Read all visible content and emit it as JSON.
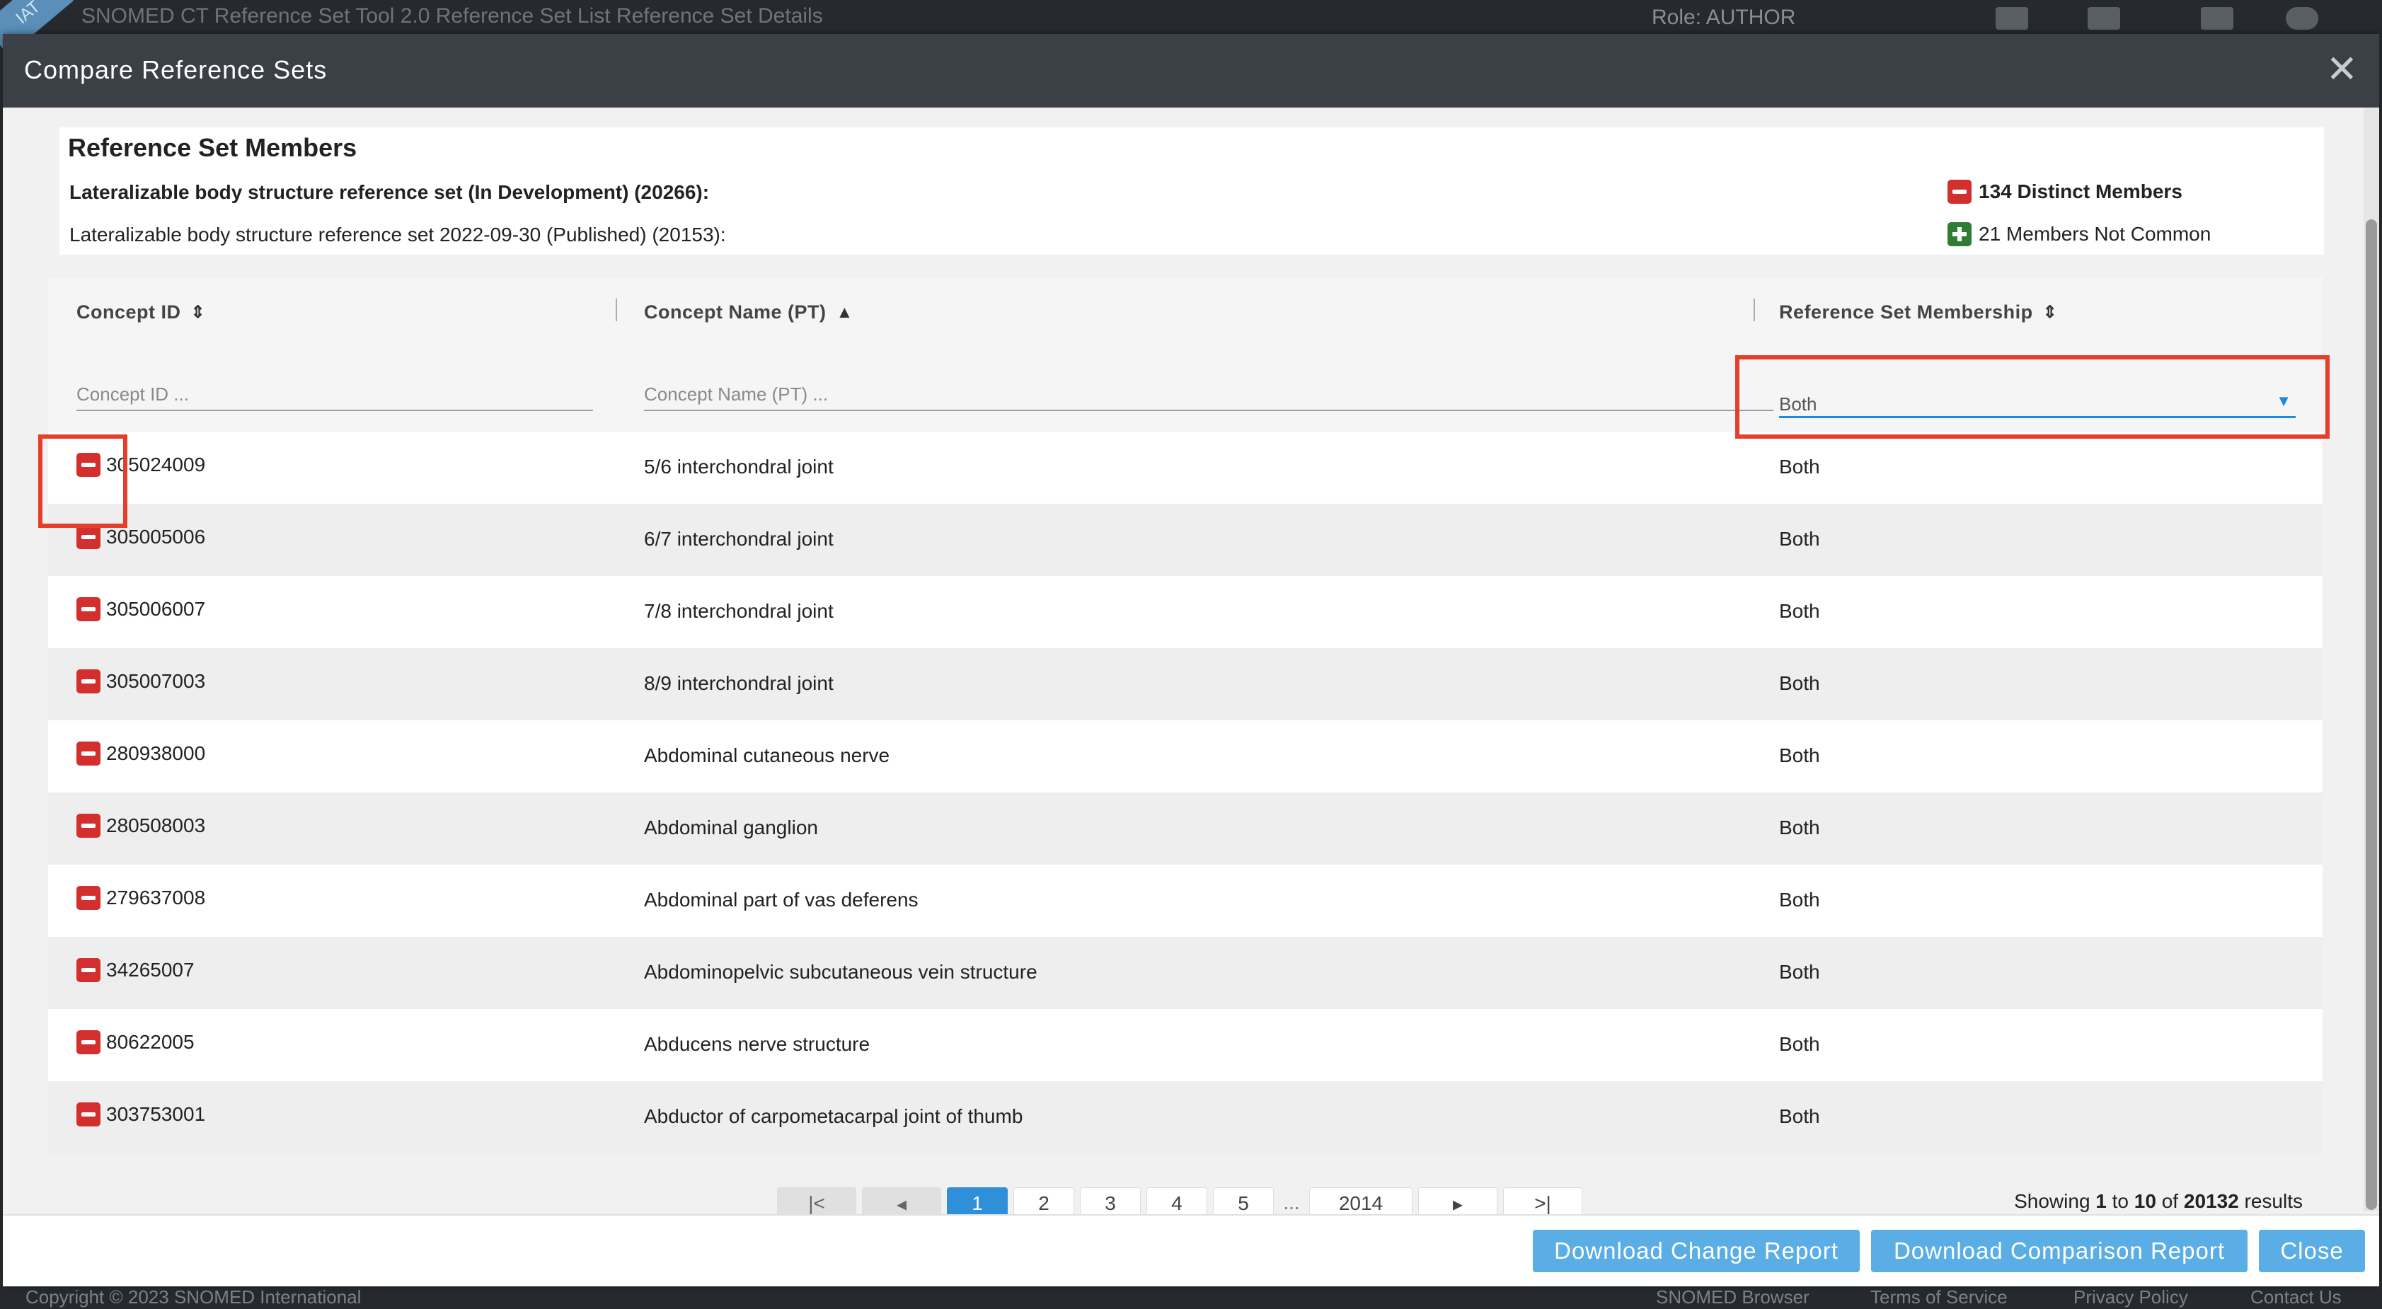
{
  "background": {
    "ribbon": "IAT",
    "app_title": "SNOMED CT Reference Set Tool 2.0   Reference Set List   Reference Set Details",
    "role": "Role: AUTHOR",
    "footer_left": "Copyright © 2023 SNOMED International",
    "footer_links": [
      "SNOMED Browser",
      "Terms of Service",
      "Privacy Policy",
      "Contact Us"
    ]
  },
  "modal": {
    "title": "Compare Reference Sets",
    "close": "✕"
  },
  "summary": {
    "title": "Reference Set Members",
    "line1": "Lateralizable body structure reference set (In Development) (20266):",
    "line2": "Lateralizable body structure reference set 2022-09-30 (Published) (20153):",
    "stat1": "134 Distinct Members",
    "stat2": "21 Members Not Common"
  },
  "table": {
    "columns": [
      {
        "label": "Concept ID",
        "sort": "⇕"
      },
      {
        "label": "Concept Name (PT)",
        "sort": "▲"
      },
      {
        "label": "Reference Set Membership",
        "sort": "⇕"
      }
    ],
    "filters": {
      "concept_id_placeholder": "Concept ID ...",
      "concept_name_placeholder": "Concept Name (PT) ...",
      "membership_value": "Both"
    },
    "rows": [
      {
        "id": "305024009",
        "name": "5/6 interchondral joint",
        "membership": "Both"
      },
      {
        "id": "305005006",
        "name": "6/7 interchondral joint",
        "membership": "Both"
      },
      {
        "id": "305006007",
        "name": "7/8 interchondral joint",
        "membership": "Both"
      },
      {
        "id": "305007003",
        "name": "8/9 interchondral joint",
        "membership": "Both"
      },
      {
        "id": "280938000",
        "name": "Abdominal cutaneous nerve",
        "membership": "Both"
      },
      {
        "id": "280508003",
        "name": "Abdominal ganglion",
        "membership": "Both"
      },
      {
        "id": "279637008",
        "name": "Abdominal part of vas deferens",
        "membership": "Both"
      },
      {
        "id": "34265007",
        "name": "Abdominopelvic subcutaneous vein structure",
        "membership": "Both"
      },
      {
        "id": "80622005",
        "name": "Abducens nerve structure",
        "membership": "Both"
      },
      {
        "id": "303753001",
        "name": "Abductor of carpometacarpal joint of thumb",
        "membership": "Both"
      }
    ]
  },
  "pagination": {
    "first": "|<",
    "prev": "◂",
    "pages": [
      "1",
      "2",
      "3",
      "4",
      "5"
    ],
    "ellipsis": "...",
    "last_page": "2014",
    "next": "▸",
    "last": ">|",
    "showing_prefix": "Showing",
    "showing_from": "1",
    "showing_to_word": "to",
    "showing_to": "10",
    "showing_of_word": "of",
    "showing_total": "20132",
    "showing_suffix": "results"
  },
  "buttons": {
    "download_change": "Download Change Report",
    "download_comparison": "Download Comparison Report",
    "close": "Close"
  },
  "colors": {
    "accent": "#2f8fd8",
    "button": "#5aaee5",
    "minus_badge": "#d32f2f",
    "plus_badge": "#2e7d32",
    "highlight": "#e53e2b"
  }
}
